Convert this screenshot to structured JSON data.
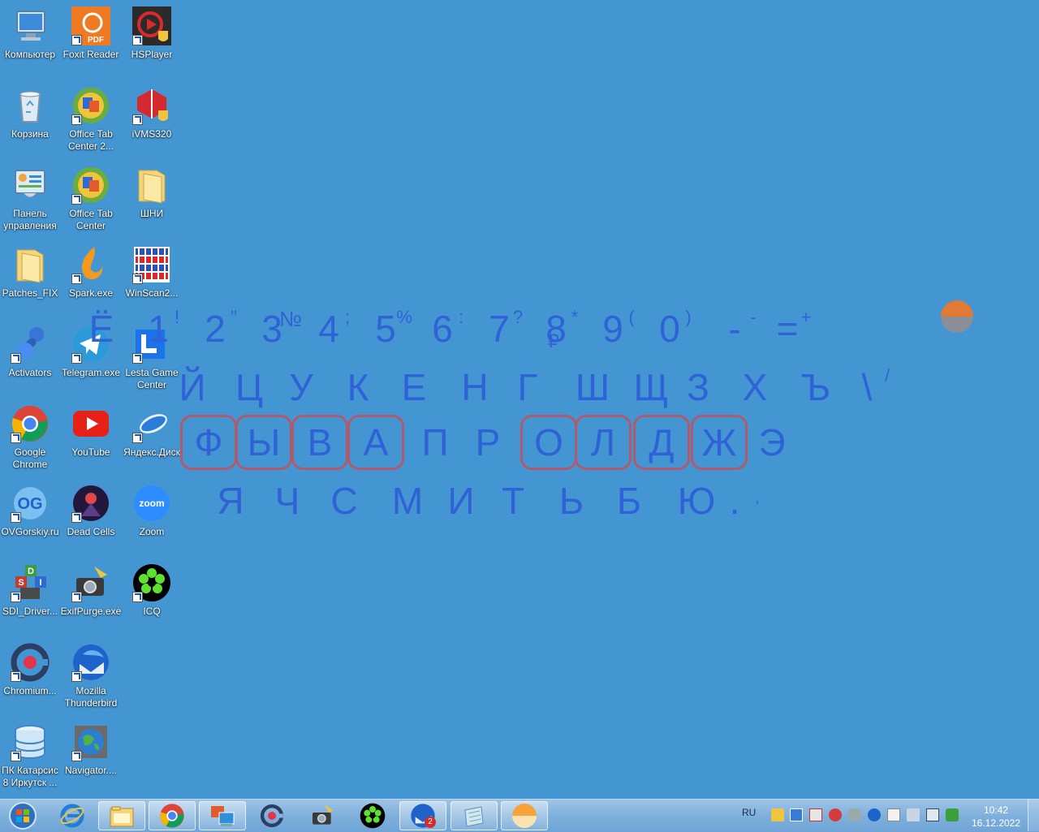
{
  "desktop": {
    "icons": [
      {
        "label": "Компьютер"
      },
      {
        "label": "Foxit Reader"
      },
      {
        "label": "HSPlayer"
      },
      {
        "label": "Корзина"
      },
      {
        "label": "Office Tab Center 2..."
      },
      {
        "label": "iVMS320"
      },
      {
        "label": "Панель управления"
      },
      {
        "label": "Office Tab Center"
      },
      {
        "label": "ШНИ"
      },
      {
        "label": "Patches_FIX"
      },
      {
        "label": "Spark.exe"
      },
      {
        "label": "WinScan2..."
      },
      {
        "label": "Activators"
      },
      {
        "label": "Telegram.exe"
      },
      {
        "label": "Lesta Game Center"
      },
      {
        "label": "Google Chrome"
      },
      {
        "label": "YouTube"
      },
      {
        "label": "Яндекс.Диск"
      },
      {
        "label": "OVGorskiy.ru"
      },
      {
        "label": "Dead Cells"
      },
      {
        "label": "Zoom"
      },
      {
        "label": "SDI_Driver..."
      },
      {
        "label": "ExifPurge.exe"
      },
      {
        "label": "ICQ"
      },
      {
        "label": "Chromium..."
      },
      {
        "label": "Mozilla Thunderbird"
      },
      {
        "label": "ПК Катарсис 8 Иркутск ..."
      },
      {
        "label": "Navigator...."
      }
    ],
    "icon_glyphs": {
      "foxit": "PDF",
      "zoom": "zoom",
      "sdi": [
        "D",
        "S",
        "I"
      ]
    }
  },
  "keyboard": {
    "row1": [
      {
        "main": "Ё",
        "sub": ""
      },
      {
        "main": "1",
        "sub": "!"
      },
      {
        "main": "2",
        "sub": "\""
      },
      {
        "main": "3",
        "sub": "№"
      },
      {
        "main": "4",
        "sub": ";"
      },
      {
        "main": "5",
        "sub": "%"
      },
      {
        "main": "6",
        "sub": ":"
      },
      {
        "main": "7",
        "sub": "?"
      },
      {
        "main": "8",
        "sub": "*",
        "sub2": "₽"
      },
      {
        "main": "9",
        "sub": "("
      },
      {
        "main": "0",
        "sub": ")"
      },
      {
        "main": "-",
        "sub": "-"
      },
      {
        "main": "=",
        "sub": "+"
      }
    ],
    "row2": [
      "Й",
      "Ц",
      "У",
      "К",
      "Е",
      "Н",
      "Г",
      "Ш",
      "Щ",
      "З",
      "Х",
      "Ъ",
      "\\"
    ],
    "row2_extra": "/",
    "row3": [
      "Ф",
      "Ы",
      "В",
      "А",
      "П",
      "Р",
      "О",
      "Л",
      "Д",
      "Ж",
      "Э"
    ],
    "row3_highlighted": [
      true,
      true,
      true,
      true,
      false,
      false,
      true,
      true,
      true,
      true,
      false
    ],
    "row4": [
      "Я",
      "Ч",
      "С",
      "М",
      "И",
      "Т",
      "Ь",
      "Б",
      "Ю",
      "."
    ],
    "row4_extra": ",",
    "colors": {
      "text": "#2f62d6",
      "highlight_border": "#b05a6d"
    }
  },
  "taskbar": {
    "lang": "RU",
    "clock_time": "10:42",
    "clock_date": "16.12.2022",
    "thunderbird_badge": "2",
    "buttons": [
      {
        "icon": "start-orb-icon"
      },
      {
        "icon": "internet-explorer-icon"
      },
      {
        "icon": "file-explorer-icon"
      },
      {
        "icon": "chrome-icon"
      },
      {
        "icon": "remote-app-icon"
      },
      {
        "icon": "chromium-icon"
      },
      {
        "icon": "exifpurge-icon"
      },
      {
        "icon": "icq-icon"
      },
      {
        "icon": "thunderbird-icon"
      },
      {
        "icon": "notepad-icon"
      },
      {
        "icon": "sun-widget-icon"
      }
    ]
  }
}
